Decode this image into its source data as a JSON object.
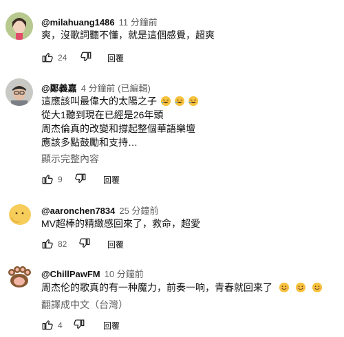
{
  "comments": [
    {
      "handle": "@milahuang1486",
      "time": "11 分鐘前",
      "lines": [
        "爽，沒歌詞聽不懂，就是這個感覺，超爽"
      ],
      "likes": "24",
      "reply": "回覆"
    },
    {
      "handle": "@鄭義嘉",
      "time": "4 分鐘前 (已編輯)",
      "lines": [
        "這應該叫最偉大的太陽之子",
        "從大1聽到現在已經是26年頭",
        "周杰倫真的改變和撐起整個華語樂壇",
        "應該多點鼓勵和支持…"
      ],
      "line1_emojis": [
        "rolling-laugh",
        "rolling-laugh",
        "rolling-laugh"
      ],
      "more": "顯示完整內容",
      "likes": "9",
      "reply": "回覆"
    },
    {
      "handle": "@aaronchen7834",
      "time": "25 分鐘前",
      "lines": [
        "MV超棒的精緻感回來了，救命，超愛"
      ],
      "likes": "82",
      "reply": "回覆"
    },
    {
      "handle": "@ChillPawFM",
      "time": "10 分鐘前",
      "lines": [
        "周杰伦的歌真的有一种魔力，前奏一响，青春就回来了"
      ],
      "line1_emojis": [
        "smile",
        "smile",
        "smile"
      ],
      "more": "翻譯成中文（台灣）",
      "likes": "4",
      "reply": "回覆"
    }
  ],
  "colors": {
    "text": "#0f0f0f",
    "secondary": "#606060",
    "emoji": "#f7c23d"
  },
  "icons": [
    "thumb-up-icon",
    "thumb-down-icon"
  ]
}
